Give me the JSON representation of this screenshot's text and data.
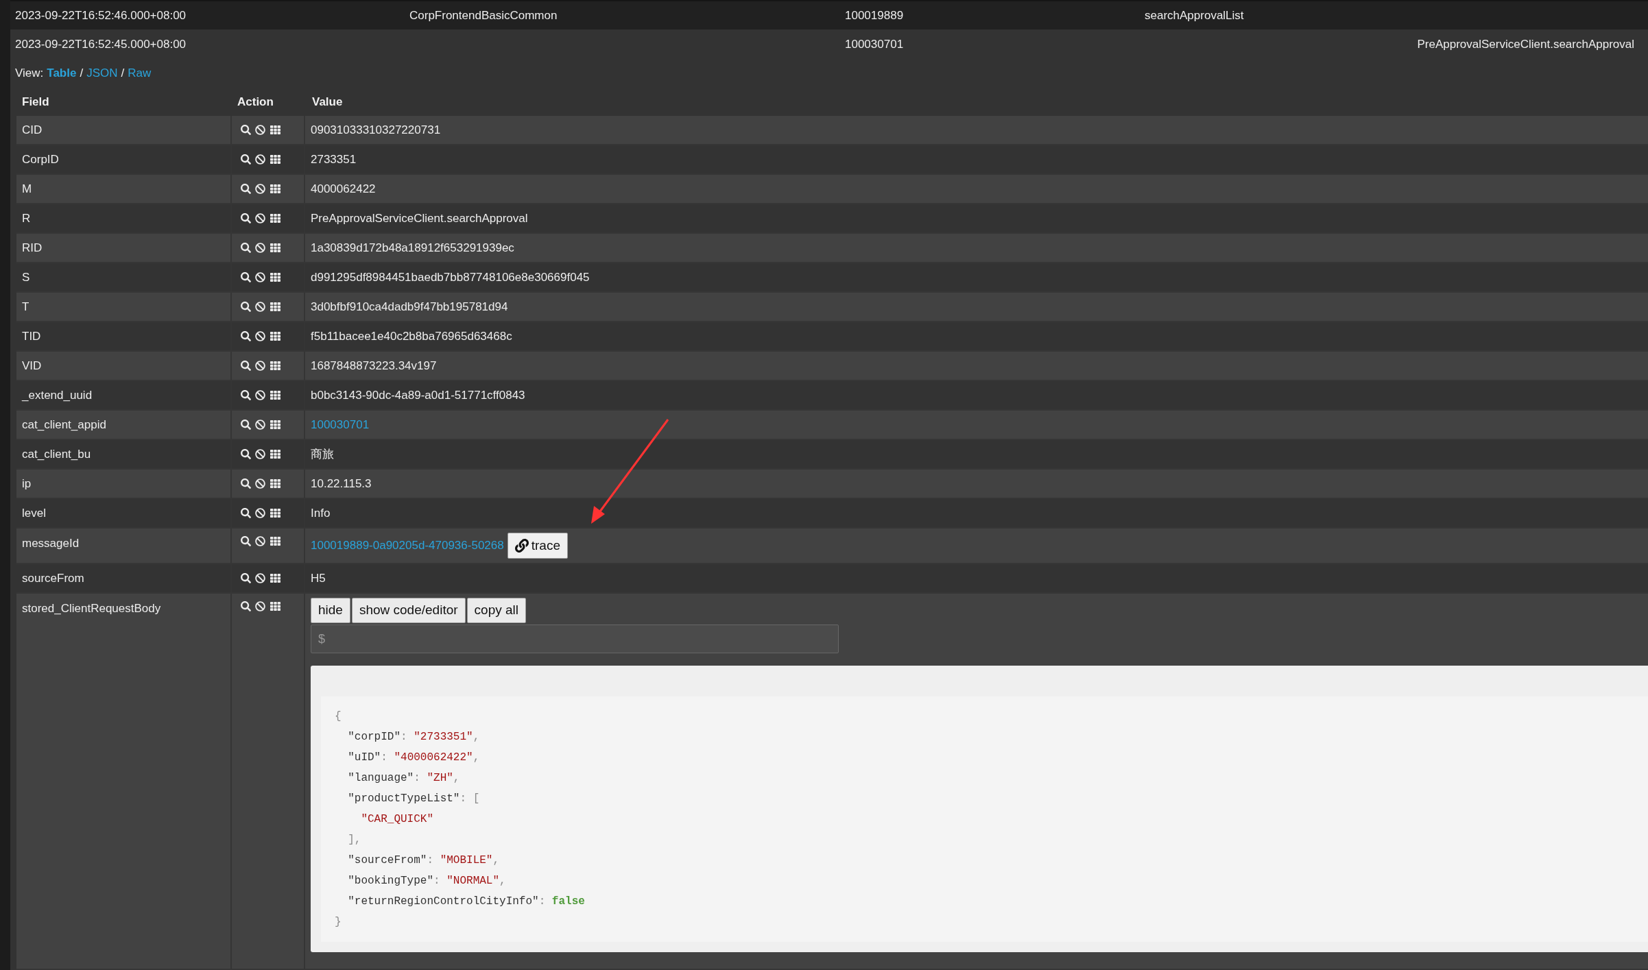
{
  "top_rows": [
    {
      "column_1": "2023-09-22T16:52:46.000+08:00",
      "column_2": "CorpFrontendBasicCommon",
      "column_3": "100019889",
      "column_4": "searchApprovalList"
    },
    {
      "column_1": "2023-09-22T16:52:45.000+08:00",
      "column_3": "100030701",
      "column_5": "PreApprovalServiceClient.searchApproval"
    }
  ],
  "view": {
    "label": "View:",
    "options": [
      {
        "label": "Table",
        "selected": true
      },
      {
        "label": "JSON",
        "selected": false
      },
      {
        "label": "Raw",
        "selected": false
      }
    ],
    "separator": "/"
  },
  "table": {
    "columns": [
      "Field",
      "Action",
      "Value"
    ],
    "rows": [
      {
        "field": "CID",
        "kind": "text",
        "value": "09031033310327220731"
      },
      {
        "field": "CorpID",
        "kind": "text",
        "value": "2733351"
      },
      {
        "field": "M",
        "kind": "text",
        "value": "4000062422"
      },
      {
        "field": "R",
        "kind": "text",
        "value": "PreApprovalServiceClient.searchApproval"
      },
      {
        "field": "RID",
        "kind": "text",
        "value": "1a30839d172b48a18912f653291939ec"
      },
      {
        "field": "S",
        "kind": "text",
        "value": "d991295df8984451baedb7bb87748106e8e30669f045"
      },
      {
        "field": "T",
        "kind": "text",
        "value": "3d0bfbf910ca4dadb9f47bb195781d94"
      },
      {
        "field": "TID",
        "kind": "text",
        "value": "f5b11bacee1e40c2b8ba76965d63468c"
      },
      {
        "field": "VID",
        "kind": "text",
        "value": "1687848873223.34v197"
      },
      {
        "field": "_extend_uuid",
        "kind": "text",
        "value": "b0bc3143-90dc-4a89-a0d1-51771cff0843"
      },
      {
        "field": "cat_client_appid",
        "kind": "link",
        "value": "100030701"
      },
      {
        "field": "cat_client_bu",
        "kind": "text",
        "value": "商旅"
      },
      {
        "field": "ip",
        "kind": "text",
        "value": "10.22.115.3"
      },
      {
        "field": "level",
        "kind": "text",
        "value": "Info"
      },
      {
        "field": "messageId",
        "kind": "trace",
        "value": "100019889-0a90205d-470936-50268",
        "button": "trace"
      },
      {
        "field": "sourceFrom",
        "kind": "text",
        "value": "H5"
      },
      {
        "field": "stored_ClientRequestBody",
        "kind": "body",
        "buttons": [
          "hide",
          "show code/editor",
          "copy all"
        ],
        "placeholder": "$",
        "code": [
          [
            {
              "kind": "punct",
              "text": "{"
            }
          ],
          [
            {
              "kind": "key",
              "text": "  \"corpID\""
            },
            {
              "kind": "punct",
              "text": ": "
            },
            {
              "kind": "string",
              "text": "\"2733351\""
            },
            {
              "kind": "punct",
              "text": ","
            }
          ],
          [
            {
              "kind": "key",
              "text": "  \"uID\""
            },
            {
              "kind": "punct",
              "text": ": "
            },
            {
              "kind": "string",
              "text": "\"4000062422\""
            },
            {
              "kind": "punct",
              "text": ","
            }
          ],
          [
            {
              "kind": "key",
              "text": "  \"language\""
            },
            {
              "kind": "punct",
              "text": ": "
            },
            {
              "kind": "string",
              "text": "\"ZH\""
            },
            {
              "kind": "punct",
              "text": ","
            }
          ],
          [
            {
              "kind": "key",
              "text": "  \"productTypeList\""
            },
            {
              "kind": "punct",
              "text": ": ["
            }
          ],
          [
            {
              "kind": "string",
              "text": "    \"CAR_QUICK\""
            }
          ],
          [
            {
              "kind": "punct",
              "text": "  ],"
            }
          ],
          [
            {
              "kind": "key",
              "text": "  \"sourceFrom\""
            },
            {
              "kind": "punct",
              "text": ": "
            },
            {
              "kind": "string",
              "text": "\"MOBILE\""
            },
            {
              "kind": "punct",
              "text": ","
            }
          ],
          [
            {
              "kind": "key",
              "text": "  \"bookingType\""
            },
            {
              "kind": "punct",
              "text": ": "
            },
            {
              "kind": "string",
              "text": "\"NORMAL\""
            },
            {
              "kind": "punct",
              "text": ","
            }
          ],
          [
            {
              "kind": "key",
              "text": "  \"returnRegionControlCityInfo\""
            },
            {
              "kind": "punct",
              "text": ": "
            },
            {
              "kind": "boolean",
              "text": "false"
            }
          ],
          [
            {
              "kind": "punct",
              "text": "}"
            }
          ]
        ]
      }
    ]
  }
}
